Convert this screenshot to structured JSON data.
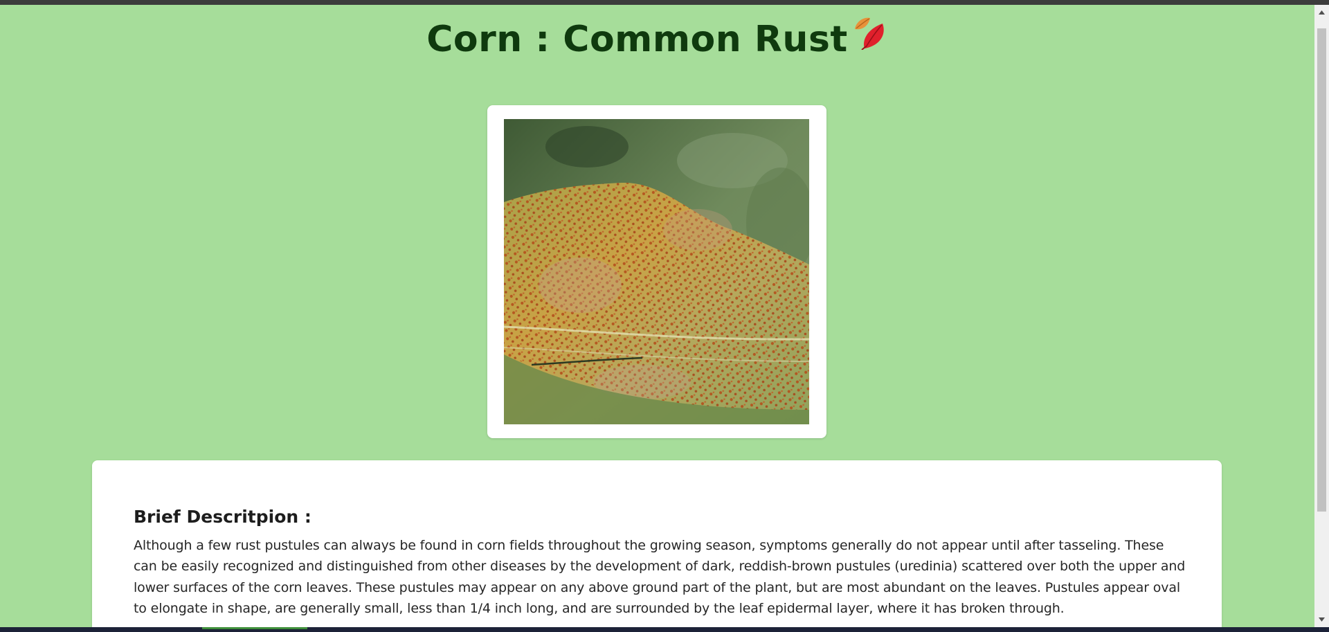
{
  "page": {
    "title": "Corn : Common Rust",
    "title_icon": "fallen-leaf-icon",
    "image": {
      "subject": "corn-leaf-with-rust-pustules-photo"
    }
  },
  "description": {
    "heading": "Brief Descritpion :",
    "text": "Although a few rust pustules can always be found in corn fields throughout the growing season, symptoms generally do not appear until after tasseling. These can be easily recognized and distinguished from other diseases by the development of dark, reddish-brown pustules (uredinia) scattered over both the upper and lower surfaces of the corn leaves. These pustules may appear on any above ground part of the plant, but are most abundant on the leaves. Pustules appear oval to elongate in shape, are generally small, less than 1/4 inch long, and are surrounded by the leaf epidermal layer, where it has broken through."
  },
  "colors": {
    "background": "#a6dd9a",
    "title": "#0f3a0e",
    "card": "#ffffff"
  },
  "scrollbar": {
    "up_icon": "scroll-up-arrow-icon",
    "down_icon": "scroll-down-arrow-icon"
  }
}
